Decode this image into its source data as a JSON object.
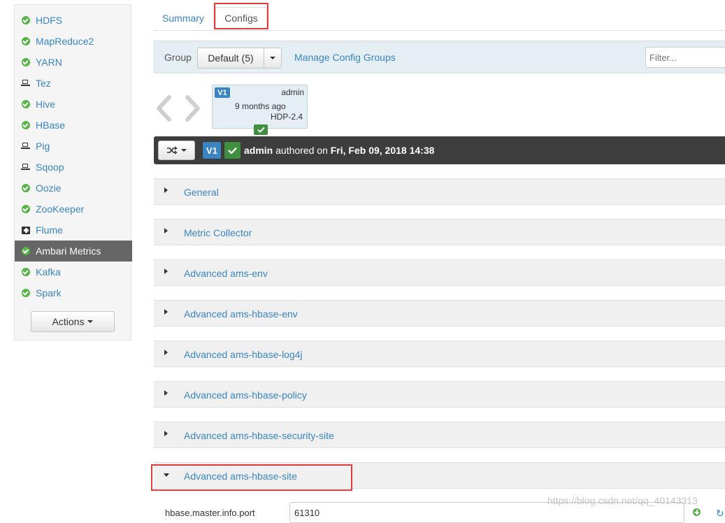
{
  "sidebar": {
    "services": [
      {
        "label": "HDFS",
        "icon": "check-circle-icon",
        "active": false
      },
      {
        "label": "MapReduce2",
        "icon": "check-circle-icon",
        "active": false
      },
      {
        "label": "YARN",
        "icon": "check-circle-icon",
        "active": false
      },
      {
        "label": "Tez",
        "icon": "laptop-icon",
        "active": false
      },
      {
        "label": "Hive",
        "icon": "check-circle-icon",
        "active": false
      },
      {
        "label": "HBase",
        "icon": "check-circle-icon",
        "active": false
      },
      {
        "label": "Pig",
        "icon": "laptop-icon",
        "active": false
      },
      {
        "label": "Sqoop",
        "icon": "laptop-icon",
        "active": false
      },
      {
        "label": "Oozie",
        "icon": "check-circle-icon",
        "active": false
      },
      {
        "label": "ZooKeeper",
        "icon": "check-circle-icon",
        "active": false
      },
      {
        "label": "Flume",
        "icon": "medkit-icon",
        "active": false
      },
      {
        "label": "Ambari Metrics",
        "icon": "check-circle-icon",
        "active": true
      },
      {
        "label": "Kafka",
        "icon": "check-circle-icon",
        "active": false
      },
      {
        "label": "Spark",
        "icon": "check-circle-icon",
        "active": false
      }
    ],
    "actions_label": "Actions"
  },
  "tabs": {
    "summary": "Summary",
    "configs": "Configs"
  },
  "group_bar": {
    "label": "Group",
    "selected": "Default (5)",
    "manage_link": "Manage Config Groups",
    "filter_placeholder": "Filter..."
  },
  "version_card": {
    "version": "V1",
    "author": "admin",
    "ago": "9 months ago",
    "stack": "HDP-2.4"
  },
  "info_bar": {
    "version": "V1",
    "author": "admin",
    "authored_text": " authored on ",
    "date": "Fri, Feb 09, 2018 14:38"
  },
  "panels": [
    {
      "title": "General",
      "expanded": false
    },
    {
      "title": "Metric Collector",
      "expanded": false
    },
    {
      "title": "Advanced ams-env",
      "expanded": false
    },
    {
      "title": "Advanced ams-hbase-env",
      "expanded": false
    },
    {
      "title": "Advanced ams-hbase-log4j",
      "expanded": false
    },
    {
      "title": "Advanced ams-hbase-policy",
      "expanded": false
    },
    {
      "title": "Advanced ams-hbase-security-site",
      "expanded": false
    },
    {
      "title": "Advanced ams-hbase-site",
      "expanded": true
    }
  ],
  "property": {
    "name": "hbase.master.info.port",
    "value": "61310"
  },
  "watermark": "https://blog.csdn.net/qq_40143313",
  "colors": {
    "link": "#3a85c1",
    "success": "#5ab449",
    "highlight": "#e23b3b",
    "active_bg": "#666666"
  }
}
